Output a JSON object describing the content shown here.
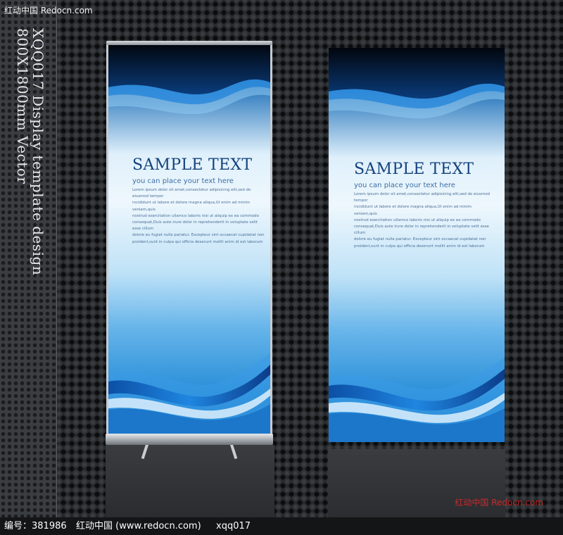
{
  "watermark": {
    "top_left": "红动中国  Redocn.com",
    "bottom_right": "红动中国  Redocn.com"
  },
  "side_title": {
    "line1": "XQQ017 Display template design",
    "line2": "800X1800mm Vector"
  },
  "banners": [
    {
      "title": "SAMPLE TEXT",
      "subtitle": "you can place your text here",
      "body_lines": [
        "Lorem ipsum dolor sit amet,consectetur adipisicing elit,sed do eiusmod tempor",
        "incididunt ut labore et dolore magna aliqua,Ut enim ad minim veniam,quis",
        "nostrud exercitation ullamco laboris nisi ut aliquip ex ea commodo",
        "consequat,Duis aute irure dolor in reprehenderit in voluptate velit esse cillum",
        "dolore eu fugiat nulla pariatur. Excepteur sint occaecat cupidatat non",
        "proident,sunt in culpa qui officia deserunt mollit anim id est laborum"
      ]
    },
    {
      "title": "SAMPLE TEXT",
      "subtitle": "you can place your text here",
      "body_lines": [
        "Lorem ipsum dolor sit amet,consectetur adipisicing elit,sed do eiusmod tempor",
        "incididunt ut labore et dolore magna aliqua,Ut enim ad minim veniam,quis",
        "nostrud exercitation ullamco laboris nisi ut aliquip ex ea commodo",
        "consequat,Duis aute irure dolor in reprehenderit in voluptate velit esse cillum",
        "dolore eu fugiat nulla pariatur. Excepteur sint occaecat cupidatat non",
        "proident,sunt in culpa qui officia deserunt mollit anim id est laborum"
      ]
    }
  ],
  "footer": {
    "id_label": "编号：381986",
    "site": "红动中国 (www.redocn.com)",
    "code": "xqq017"
  },
  "colors": {
    "banner_blue": "#1f7fcc",
    "title_navy": "#14427e",
    "watermark_red": "#e12a2a"
  }
}
